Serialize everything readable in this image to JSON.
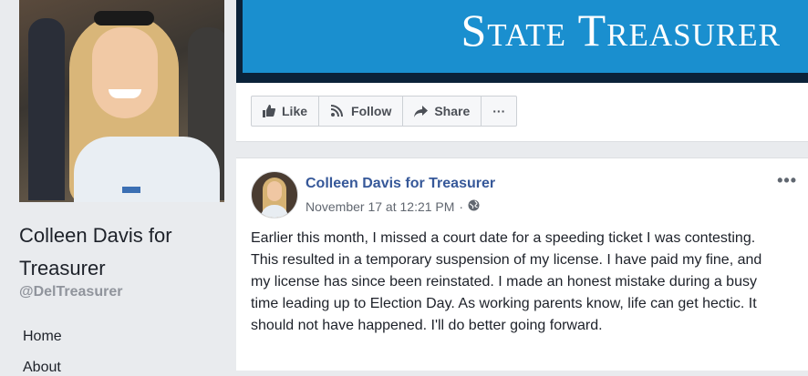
{
  "page": {
    "name": "Colleen Davis for Treasurer",
    "handle": "@DelTreasurer",
    "nav": {
      "home": "Home",
      "about": "About"
    }
  },
  "cover": {
    "text": "State Treasurer",
    "banner_color": "#1a8fcf",
    "frame_color": "#0b2239"
  },
  "actions": {
    "like": "Like",
    "follow": "Follow",
    "share": "Share",
    "more": "···"
  },
  "post": {
    "author": "Colleen Davis for Treasurer",
    "timestamp": "November 17 at 12:21 PM",
    "separator": "·",
    "privacy_icon": "globe-icon",
    "options": "•••",
    "text": "Earlier this month, I missed a court date for a speeding ticket I was contesting. This resulted in a temporary suspension of my license. I have paid my fine, and my license has since been reinstated. I made an honest mistake during a busy time leading up to Election Day. As working parents know, life can get hectic. It should not have happened. I'll do better going forward."
  },
  "colors": {
    "link": "#365899",
    "text": "#1d2129",
    "muted": "#616770",
    "background": "#e9ebee"
  }
}
